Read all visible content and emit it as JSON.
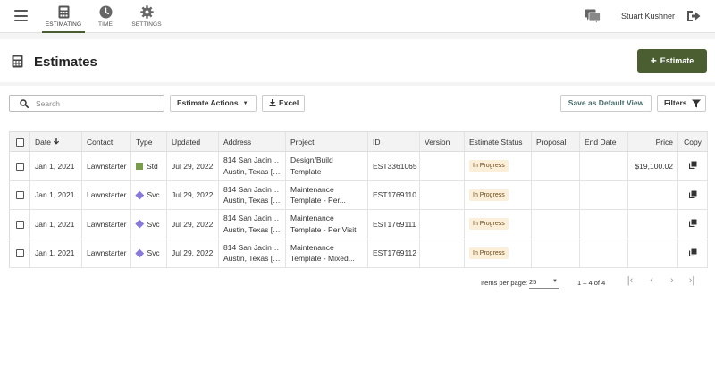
{
  "nav": {
    "tabs": [
      {
        "label": "ESTIMATING",
        "icon": "calculator-icon"
      },
      {
        "label": "TIME",
        "icon": "clock-icon"
      },
      {
        "label": "SETTINGS",
        "icon": "gear-icon"
      }
    ],
    "user_name": "Stuart Kushner"
  },
  "header": {
    "title": "Estimates",
    "new_button": "Estimate"
  },
  "toolbar": {
    "search_placeholder": "Search",
    "actions_label": "Estimate Actions",
    "excel_label": "Excel",
    "save_default_label": "Save as Default View",
    "filters_label": "Filters"
  },
  "table": {
    "columns": [
      "Date",
      "Contact",
      "Type",
      "Updated",
      "Address",
      "Project",
      "ID",
      "Version",
      "Estimate Status",
      "Proposal",
      "End Date",
      "Price",
      "Copy"
    ],
    "rows": [
      {
        "date": "Jan 1, 2021",
        "contact": "Lawnstarter",
        "type": "Std",
        "type_shape": "square",
        "updated": "Jul 29, 2022",
        "address_1": "814 San Jacinto...",
        "address_2": "Austin, Texas [7...",
        "project_1": "Design/Build",
        "project_2": "Template",
        "id": "EST3361065",
        "version": "",
        "status": "In Progress",
        "proposal": "",
        "end_date": "",
        "price": "$19,100.02"
      },
      {
        "date": "Jan 1, 2021",
        "contact": "Lawnstarter",
        "type": "Svc",
        "type_shape": "diamond",
        "updated": "Jul 29, 2022",
        "address_1": "814 San Jacinto...",
        "address_2": "Austin, Texas [7...",
        "project_1": "Maintenance",
        "project_2": "Template - Per...",
        "id": "EST1769110",
        "version": "",
        "status": "In Progress",
        "proposal": "",
        "end_date": "",
        "price": ""
      },
      {
        "date": "Jan 1, 2021",
        "contact": "Lawnstarter",
        "type": "Svc",
        "type_shape": "diamond",
        "updated": "Jul 29, 2022",
        "address_1": "814 San Jacinto...",
        "address_2": "Austin, Texas [7...",
        "project_1": "Maintenance",
        "project_2": "Template - Per Visit",
        "id": "EST1769111",
        "version": "",
        "status": "In Progress",
        "proposal": "",
        "end_date": "",
        "price": ""
      },
      {
        "date": "Jan 1, 2021",
        "contact": "Lawnstarter",
        "type": "Svc",
        "type_shape": "diamond",
        "updated": "Jul 29, 2022",
        "address_1": "814 San Jacinto...",
        "address_2": "Austin, Texas [7...",
        "project_1": "Maintenance",
        "project_2": "Template - Mixed...",
        "id": "EST1769112",
        "version": "",
        "status": "In Progress",
        "proposal": "",
        "end_date": "",
        "price": ""
      }
    ]
  },
  "pager": {
    "items_per_page_label": "Items per page:",
    "items_per_page": "25",
    "range": "1 – 4 of 4"
  },
  "colors": {
    "brand": "#4a5e32",
    "std_type": "#7a9a4c",
    "svc_type": "#8a7ad8",
    "status_bg": "#fbefd9"
  }
}
